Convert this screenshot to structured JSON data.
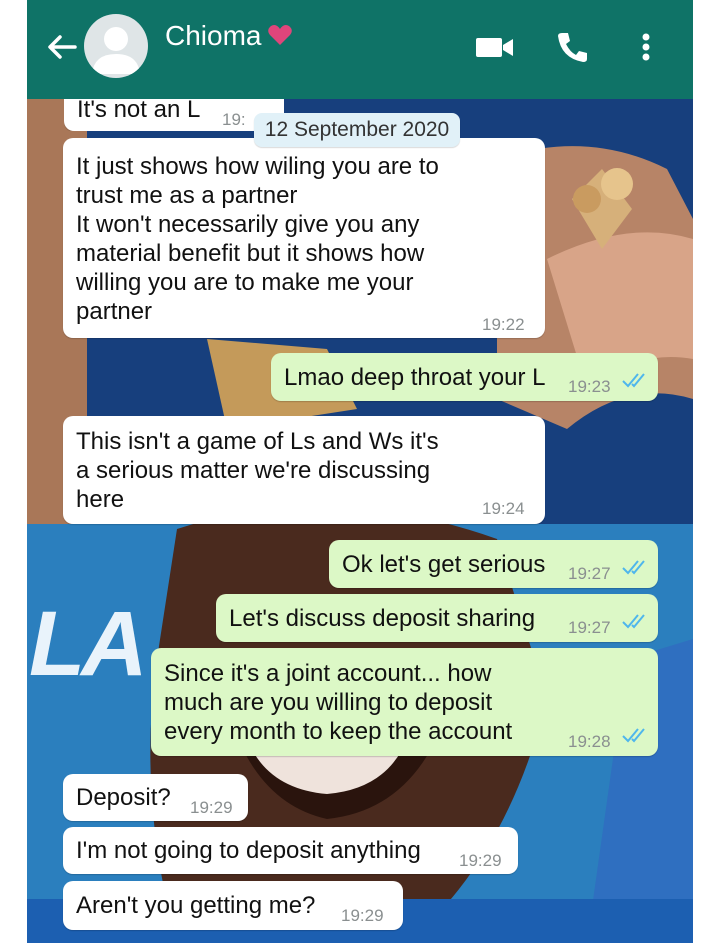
{
  "header": {
    "contact_name": "Chioma",
    "heart_color": "#e0457b",
    "back_icon": "arrow-left-icon",
    "video_icon": "video-call-icon",
    "call_icon": "phone-icon",
    "menu_icon": "more-vert-icon"
  },
  "date_label": "12 September 2020",
  "messages": [
    {
      "dir": "in",
      "text": "It's not an L",
      "time": "19:"
    },
    {
      "dir": "in",
      "text": "It just shows how wiling you are to\ntrust me as a partner\nIt won't necessarily give you any\nmaterial benefit but it shows how\nwilling you are to make me your\npartner",
      "time": "19:22"
    },
    {
      "dir": "out",
      "text": "Lmao deep throat your L",
      "time": "19:23"
    },
    {
      "dir": "in",
      "text": "This isn't a game of Ls and Ws it's\na serious matter we're discussing\nhere",
      "time": "19:24"
    },
    {
      "dir": "out",
      "text": "Ok let's get serious",
      "time": "19:27"
    },
    {
      "dir": "out",
      "text": "Let's discuss deposit sharing",
      "time": "19:27"
    },
    {
      "dir": "out",
      "text": "Since it's a joint account... how\nmuch are you willing to deposit\nevery month to keep the account",
      "time": "19:28"
    },
    {
      "dir": "in",
      "text": "Deposit?",
      "time": "19:29"
    },
    {
      "dir": "in",
      "text": "I'm not going to deposit anything",
      "time": "19:29"
    },
    {
      "dir": "in",
      "text": "Aren't you getting me?",
      "time": "19:29"
    }
  ],
  "wallpaper_text": "LA",
  "colors": {
    "header": "#0f7367",
    "incoming": "#ffffff",
    "outgoing": "#dcf8c6",
    "read_ticks": "#4fb6ec"
  }
}
